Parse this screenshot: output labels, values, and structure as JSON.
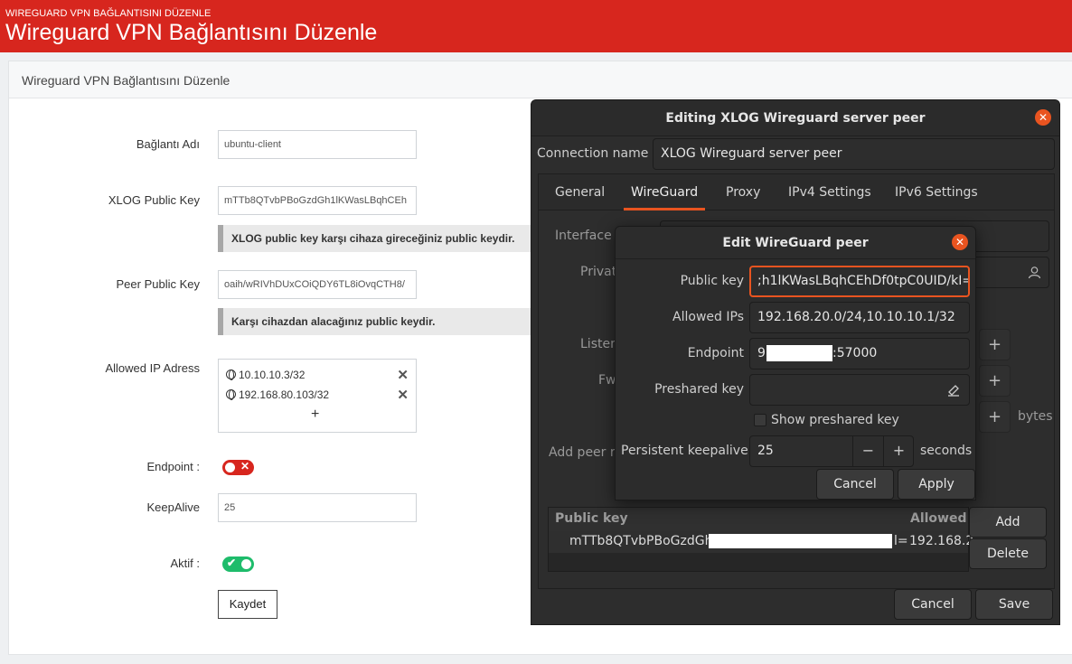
{
  "header": {
    "breadcrumb": "WIREGUARD VPN BAĞLANTISINI DÜZENLE",
    "title": "Wireguard VPN Bağlantısını Düzenle"
  },
  "card": {
    "title": "Wireguard VPN Bağlantısını Düzenle"
  },
  "form": {
    "connection_name_label": "Bağlantı Adı",
    "connection_name_value": "ubuntu-client",
    "xlog_key_label": "XLOG Public Key",
    "xlog_key_value": "mTTb8QTvbPBoGzdGh1lKWasLBqhCEh",
    "xlog_key_hint": "XLOG public key karşı cihaza gireceğiniz public keydir.",
    "peer_key_label": "Peer Public Key",
    "peer_key_value": "oaih/wRIVhDUxCOiQDY6TL8iOvqCTH8/",
    "peer_key_hint": "Karşı cihazdan alacağınız public keydir.",
    "allowed_ip_label": "Allowed IP Adress",
    "allowed_ips": [
      "10.10.10.3/32",
      "192.168.80.103/32"
    ],
    "add_ip": "+",
    "remove_ip": "✕",
    "endpoint_label": "Endpoint :",
    "endpoint_toggle": false,
    "keepalive_label": "KeepAlive",
    "keepalive_value": "25",
    "active_label": "Aktif :",
    "active_toggle": true,
    "save_button": "Kaydet"
  },
  "dialog": {
    "title": "Editing XLOG Wireguard server peer",
    "connection_name_label": "Connection name",
    "connection_name_value": "XLOG Wireguard server peer",
    "tabs": [
      "General",
      "WireGuard",
      "Proxy",
      "IPv4 Settings",
      "IPv6 Settings"
    ],
    "active_tab": "WireGuard",
    "interface_label": "Interface",
    "private_label": "Privat",
    "listen_label": "Listen",
    "fw_label": "Fw",
    "bytes_label": "bytes",
    "add_peer_label": "Add peer r",
    "peers_header_key": "Public key",
    "peers_header_ips": "Allowed I",
    "peer_row_key_start": "mTTb8QTvbPBoGzdGh",
    "peer_row_key_end": "l=",
    "peer_row_ips": "192.168.2",
    "add_button": "Add",
    "delete_button": "Delete",
    "cancel_button": "Cancel",
    "save_button": "Save"
  },
  "peer_dialog": {
    "title": "Edit WireGuard peer",
    "public_key_label": "Public key",
    "public_key_value": ";h1lKWasLBqhCEhDf0tpC0UID/kI=",
    "allowed_ips_label": "Allowed IPs",
    "allowed_ips_value": "192.168.20.0/24,10.10.10.1/32",
    "endpoint_label": "Endpoint",
    "endpoint_prefix": "9",
    "endpoint_suffix": ":57000",
    "preshared_label": "Preshared key",
    "show_preshared_label": "Show preshared key",
    "keepalive_label": "Persistent keepalive",
    "keepalive_value": "25",
    "minus": "−",
    "plus": "+",
    "seconds_label": "seconds",
    "cancel_button": "Cancel",
    "apply_button": "Apply"
  },
  "colors": {
    "brand_red": "#d7261e",
    "toggle_off": "#d7261e",
    "toggle_on": "#1ebc6b",
    "gtk_accent": "#e95420"
  }
}
